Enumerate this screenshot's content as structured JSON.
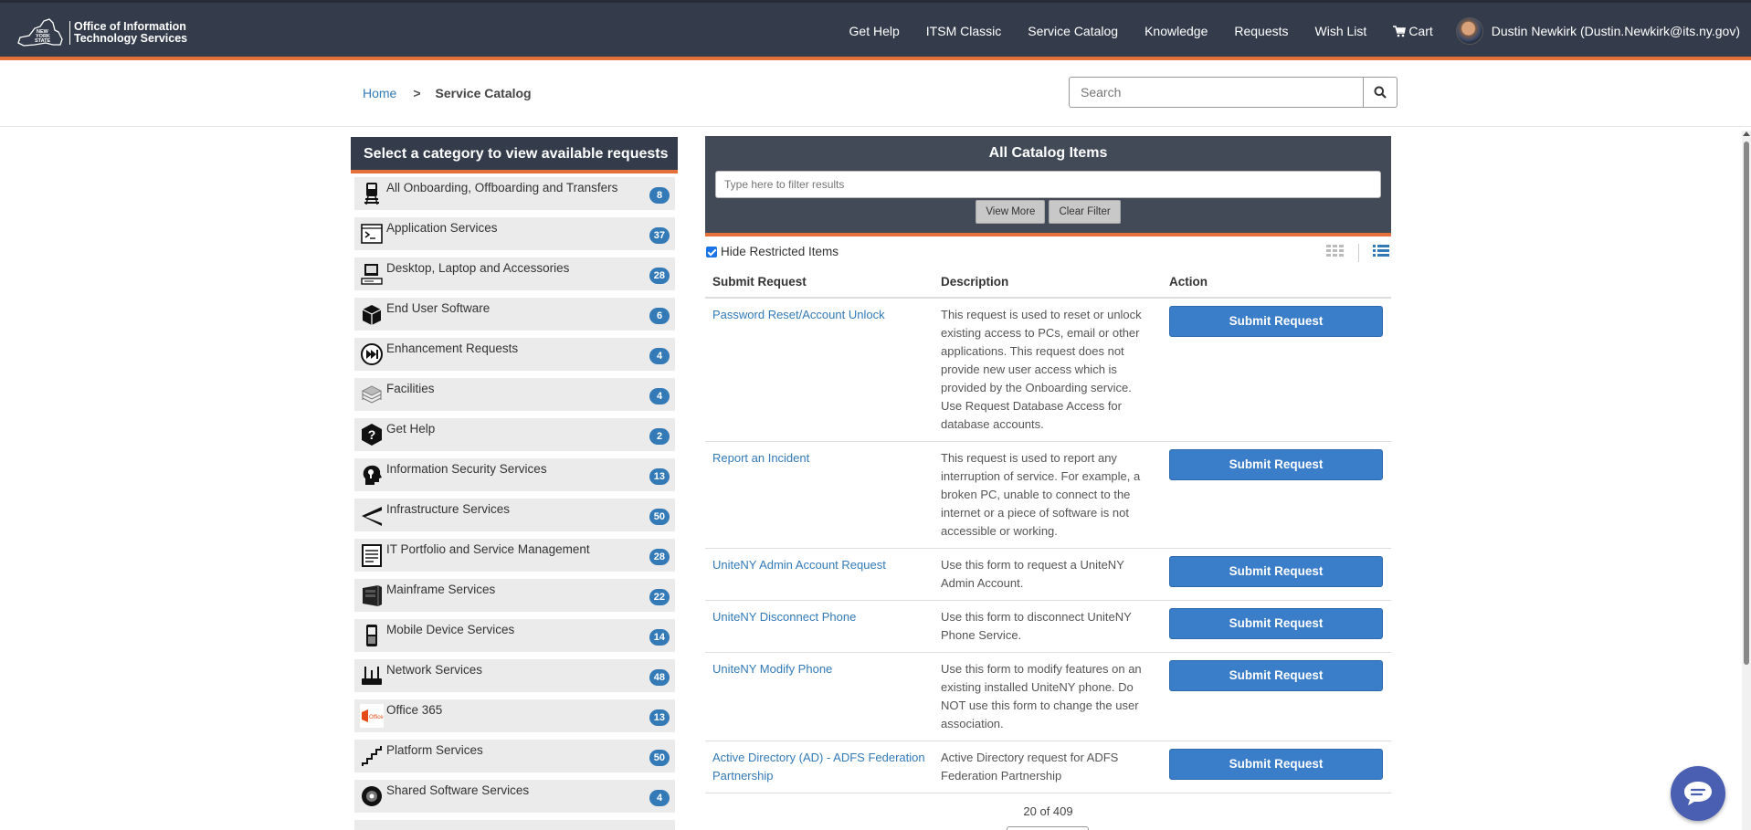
{
  "logo": {
    "line1": "Office of Information",
    "line2": "Technology Services",
    "state_mark": "NEW YORK STATE"
  },
  "nav": {
    "items": [
      "Get Help",
      "ITSM Classic",
      "Service Catalog",
      "Knowledge",
      "Requests",
      "Wish List",
      "Cart"
    ],
    "user": "Dustin Newkirk (Dustin.Newkirk@its.ny.gov)"
  },
  "breadcrumb": {
    "home": "Home",
    "separator": ">",
    "current": "Service Catalog"
  },
  "search": {
    "placeholder": "Search"
  },
  "categories": {
    "header": "Select a category to view available requests",
    "items": [
      {
        "label": "All Onboarding, Offboarding and Transfers",
        "count": "8",
        "icon": "train-icon"
      },
      {
        "label": "Application Services",
        "count": "37",
        "icon": "terminal-window-icon"
      },
      {
        "label": "Desktop, Laptop and Accessories",
        "count": "28",
        "icon": "desktop-computer-icon"
      },
      {
        "label": "End User Software",
        "count": "6",
        "icon": "software-box-icon"
      },
      {
        "label": "Enhancement Requests",
        "count": "4",
        "icon": "fast-forward-icon"
      },
      {
        "label": "Facilities",
        "count": "4",
        "icon": "building-icon"
      },
      {
        "label": "Get Help",
        "count": "2",
        "icon": "help-question-icon"
      },
      {
        "label": "Information Security Services",
        "count": "13",
        "icon": "security-head-icon"
      },
      {
        "label": "Infrastructure Services",
        "count": "50",
        "icon": "road-icon"
      },
      {
        "label": "IT Portfolio and Service Management",
        "count": "28",
        "icon": "document-icon"
      },
      {
        "label": "Mainframe Services",
        "count": "22",
        "icon": "mainframe-icon"
      },
      {
        "label": "Mobile Device Services",
        "count": "14",
        "icon": "mobile-phone-icon"
      },
      {
        "label": "Network Services",
        "count": "48",
        "icon": "router-icon"
      },
      {
        "label": "Office 365",
        "count": "13",
        "icon": "office-logo-icon"
      },
      {
        "label": "Platform Services",
        "count": "50",
        "icon": "stairs-icon"
      },
      {
        "label": "Shared Software Services",
        "count": "4",
        "icon": "disc-icon"
      }
    ]
  },
  "catalog": {
    "title": "All Catalog Items",
    "filter_placeholder": "Type here to filter results",
    "view_more": "View More",
    "clear_filter": "Clear Filter",
    "hide_restricted": "Hide Restricted Items",
    "hide_restricted_checked": true,
    "columns": [
      "Submit Request",
      "Description",
      "Action"
    ],
    "rows": [
      {
        "name": "Password Reset/Account Unlock",
        "description": "This request is used to reset or unlock existing access to PCs, email or other applications. This request does not provide new user access which is provided by the Onboarding service. Use Request Database Access for database accounts.",
        "action": "Submit Request"
      },
      {
        "name": "Report an Incident",
        "description": "This request is used to report any interruption of service. For example, a broken PC, unable to connect to the internet or a piece of software is not accessible or working.",
        "action": "Submit Request"
      },
      {
        "name": "UniteNY Admin Account Request",
        "description": "Use this form to request a UniteNY Admin Account.",
        "action": "Submit Request"
      },
      {
        "name": "UniteNY Disconnect Phone",
        "description": "Use this form to disconnect UniteNY Phone Service.",
        "action": "Submit Request"
      },
      {
        "name": "UniteNY Modify Phone",
        "description": "Use this form to modify features on an existing installed UniteNY phone. Do NOT use this form to change the user association.",
        "action": "Submit Request"
      },
      {
        "name": "Active Directory (AD) - ADFS Federation Partnership",
        "description": "Active Directory request for ADFS Federation Partnership",
        "action": "Submit Request"
      }
    ],
    "pager": "20 of 409"
  },
  "colors": {
    "header_bg": "#343c4b",
    "accent": "#e4703a",
    "link": "#337ab7",
    "button": "#3a7dc9",
    "badge": "#337ab7"
  }
}
